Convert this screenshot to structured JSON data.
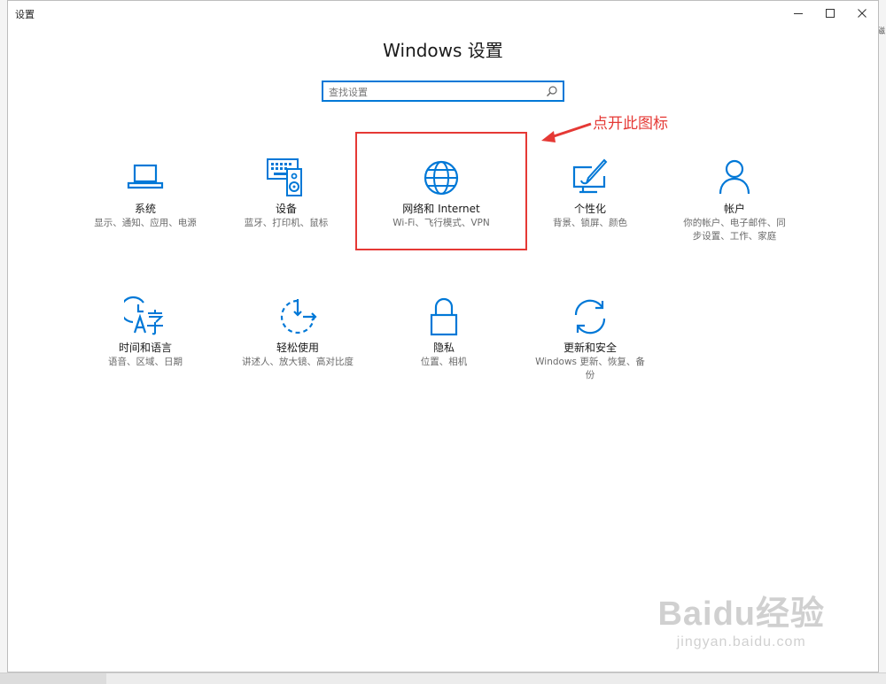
{
  "window": {
    "title": "设置"
  },
  "header": {
    "title": "Windows 设置"
  },
  "search": {
    "placeholder": "查找设置"
  },
  "categories": [
    {
      "name": "系统",
      "desc": "显示、通知、应用、电源",
      "icon": "laptop-icon"
    },
    {
      "name": "设备",
      "desc": "蓝牙、打印机、鼠标",
      "icon": "keyboard-speaker-icon"
    },
    {
      "name": "网络和 Internet",
      "desc": "Wi-Fi、飞行模式、VPN",
      "icon": "globe-icon"
    },
    {
      "name": "个性化",
      "desc": "背景、锁屏、颜色",
      "icon": "paint-brush-icon"
    },
    {
      "name": "帐户",
      "desc": "你的帐户、电子邮件、同步设置、工作、家庭",
      "icon": "person-icon"
    },
    {
      "name": "时间和语言",
      "desc": "语音、区域、日期",
      "icon": "time-language-icon"
    },
    {
      "name": "轻松使用",
      "desc": "讲述人、放大镜、高对比度",
      "icon": "ease-of-access-icon"
    },
    {
      "name": "隐私",
      "desc": "位置、相机",
      "icon": "lock-icon"
    },
    {
      "name": "更新和安全",
      "desc": "Windows 更新、恢复、备份",
      "icon": "sync-icon"
    }
  ],
  "annotation": {
    "text": "点开此图标",
    "color": "#e53935"
  },
  "background": {
    "right_edge_text": "磁"
  },
  "watermark": {
    "logo": "Baidu经验",
    "url": "jingyan.baidu.com"
  },
  "colors": {
    "accent": "#0078d7",
    "highlight": "#e53935"
  }
}
